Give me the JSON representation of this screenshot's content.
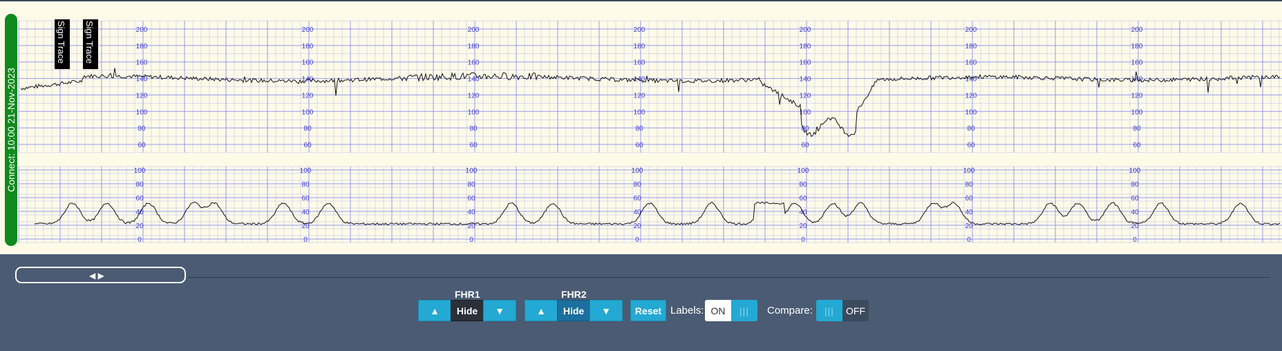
{
  "strip": {
    "connect_label": "Connect: 10:00 21-Nov-2023",
    "sign_trace_labels": [
      "Sign Trace",
      "Sign Trace"
    ],
    "fhr_scale": [
      "200",
      "180",
      "160",
      "140",
      "120",
      "100",
      "80",
      "60"
    ],
    "toco_scale": [
      "100",
      "80",
      "60",
      "40",
      "20",
      "0"
    ]
  },
  "controls": {
    "fhr1": {
      "title": "FHR1",
      "up": "▲",
      "hide": "Hide",
      "down": "▼"
    },
    "fhr2": {
      "title": "FHR2",
      "up": "▲",
      "hide": "Hide",
      "down": "▼"
    },
    "reset": "Reset",
    "labels": {
      "label": "Labels:",
      "state": "ON",
      "knob": "|||"
    },
    "compare": {
      "label": "Compare:",
      "state": "OFF",
      "knob": "|||"
    },
    "scroll_arrows": "◀ ▶"
  },
  "colors": {
    "paper": "#fdfbe8",
    "grid": "#8e8ef0",
    "accent": "#23a9d3",
    "connect": "#0f8a1c"
  }
}
